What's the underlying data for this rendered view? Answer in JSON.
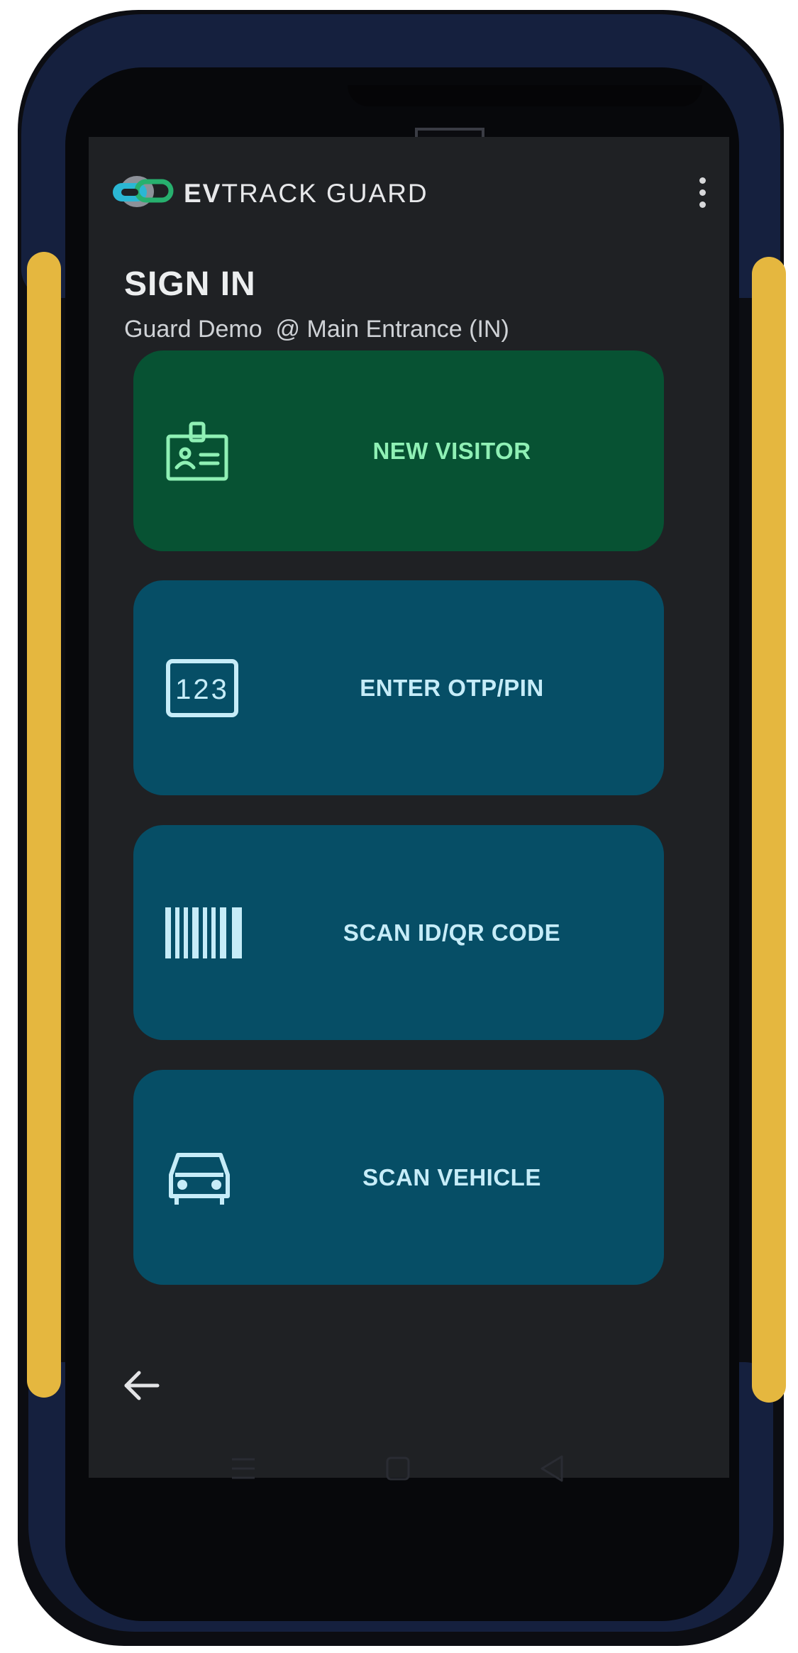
{
  "app": {
    "brand_bold": "EV",
    "brand_light": "TRACK GUARD"
  },
  "page": {
    "title": "SIGN IN",
    "subtitle": "Guard Demo  @ Main Entrance (IN)"
  },
  "actions": [
    {
      "label": "NEW VISITOR",
      "icon": "id-badge-icon"
    },
    {
      "label": "ENTER OTP/PIN",
      "icon": "numeric-123-icon"
    },
    {
      "label": "SCAN ID/QR CODE",
      "icon": "barcode-icon"
    },
    {
      "label": "SCAN VEHICLE",
      "icon": "car-icon"
    }
  ],
  "colors": {
    "screen_bg": "#1f2124",
    "primary_tile": "#075233",
    "primary_text": "#8ff0b5",
    "secondary_tile": "#064e66",
    "secondary_text": "#c6ecf8",
    "device_accent": "#e5b73f",
    "device_bezel": "#15203e"
  },
  "icons": {
    "overflow": "more-vert-icon",
    "back": "arrow-back-icon",
    "hw_menu": "hamburger-icon",
    "hw_home": "square-icon",
    "hw_back": "triangle-back-icon"
  }
}
